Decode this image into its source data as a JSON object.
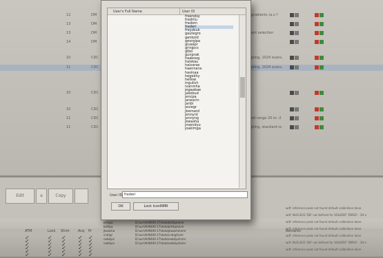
{
  "background": {
    "rows": [
      {
        "num": "12",
        "code": "DM",
        "remark": "gradients (a.s.?"
      },
      {
        "num": "13",
        "code": "DM",
        "remark": ""
      },
      {
        "num": "13",
        "code": "DM",
        "remark": "ent selection"
      },
      {
        "num": "14",
        "code": "DM",
        "remark": ""
      },
      {
        "num": "10",
        "code": "CDC",
        "remark": "pling, 1024 scans,"
      },
      {
        "num": "11",
        "code": "CDC",
        "remark": "pling, 1024 scans,"
      },
      {
        "num": "10",
        "code": "CDC",
        "remark": ""
      },
      {
        "num": "10",
        "code": "CDC",
        "remark": ""
      },
      {
        "num": "11",
        "code": "CDC",
        "remark": "ed range 20 to -2"
      },
      {
        "num": "11",
        "code": "CDC",
        "remark": "pling, standard sc"
      }
    ],
    "buttons": {
      "edit": "Edit",
      "copy": "Copy",
      "a": "a"
    },
    "table_headers": [
      "ATM",
      "Lock",
      "Shim",
      "Acq",
      "Pr",
      "Remarks"
    ],
    "remarks": [
      "wdf: reference peak not found default calibration done",
      "wdf: NUCLEUS 'DB' not defined for SOLVENT 'DMSO' - 2H n",
      "wdf: reference peak not found default calibration done",
      "wdf: reference peak not found default calibration done",
      "wdf: reference peak not found default calibration done",
      "wdf: NUCLEUS 'DB' not defined for SOLVENT 'DMSO' - 2H n",
      "wdf: reference peak not found default calibration done"
    ],
    "files": [
      {
        "user": "brittpa",
        "path": "D:\\usr\\AVIII400-17\\data\\brittpa\\nmr"
      },
      {
        "user": "brittpa",
        "path": "D:\\usr\\AVIII400-17\\data\\brittpa\\nmr"
      },
      {
        "user": "jkwasha",
        "path": "D:\\usr\\AVIII400-17\\data\\jkwasha\\nmr"
      },
      {
        "user": "cratigl",
        "path": "D:\\usr\\AVIII400-17\\data\\cratigl\\nmr"
      },
      {
        "user": "nobdyoi",
        "path": "D:\\usr\\AVIII400-17\\data\\nobdyoi\\nmr"
      },
      {
        "user": "nobdyoi",
        "path": "D:\\usr\\AVIII400-17\\data\\nobdyoi\\nmr"
      }
    ]
  },
  "dialog": {
    "col_full_name": "User's Full Name",
    "col_user_id": "User ID",
    "user_ids": [
      "freendsy",
      "fredrilu",
      "fredom",
      "frederi",
      "freydsuk",
      "gautegro",
      "genkold",
      "georgipa",
      "giusepr",
      "grinjpcs",
      "gtbo",
      "gunprak",
      "haakoog",
      "halskau",
      "halvarse",
      "haennens",
      "hasinaa",
      "hegekhy",
      "hellow",
      "ingulich",
      "ivanmha",
      "jegaabae",
      "jakobud",
      "jencpa",
      "janescin",
      "janbi",
      "jeviegr",
      "jbernard",
      "jennynt",
      "jennyng",
      "jkwasha",
      "jnsendyu",
      "joakimga"
    ],
    "selected_index": 3,
    "userid_label": "User ID",
    "userid_value": "frederi",
    "ok_label": "OK",
    "lock_label": "Lock IconNMR"
  }
}
